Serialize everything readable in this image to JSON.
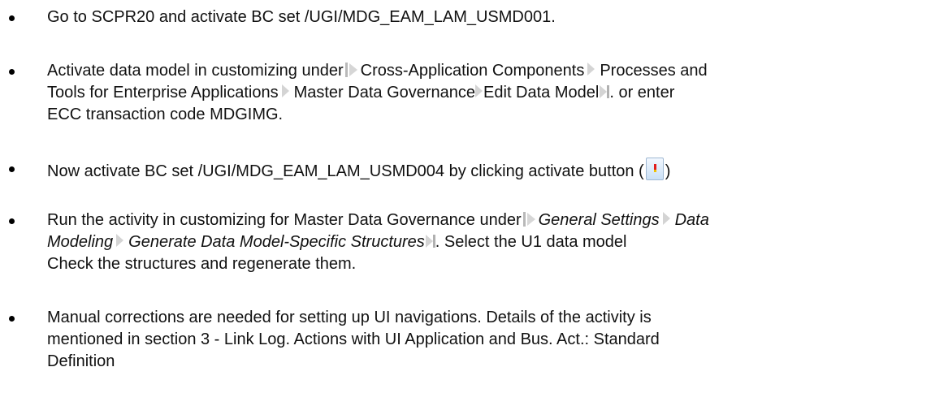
{
  "items": [
    {
      "text": "Go to SCPR20 and activate BC set /UGI/MDG_EAM_LAM_USMD001."
    },
    {
      "intro": "Activate data model in customizing under",
      "path": [
        "Cross-Application Components",
        "Processes and",
        "Tools for Enterprise Applications",
        "Master Data Governance",
        "Edit Data Model"
      ],
      "tail": ". or enter",
      "line3": "ECC transaction code MDGIMG."
    },
    {
      "before": "Now activate BC set /UGI/MDG_EAM_LAM_USMD004 by clicking activate button (",
      "icon": "activate-icon",
      "after": ")"
    },
    {
      "intro": "Run the activity in customizing for Master Data Governance under",
      "path": [
        "General Settings",
        "Data",
        "Modeling",
        "Generate Data Model-Specific Structures"
      ],
      "tail": ". Select the U1 data model",
      "line3": "Check the structures and regenerate them."
    },
    {
      "line1": "Manual corrections are needed for setting up UI navigations. Details of the activity is",
      "line2": "mentioned in section 3 - Link Log. Actions with UI Application and Bus. Act.: Standard",
      "line3": "Definition"
    }
  ],
  "colors": {
    "text": "#111111",
    "arrow": "#d4d4d4",
    "icon_red": "#e21d1d"
  }
}
